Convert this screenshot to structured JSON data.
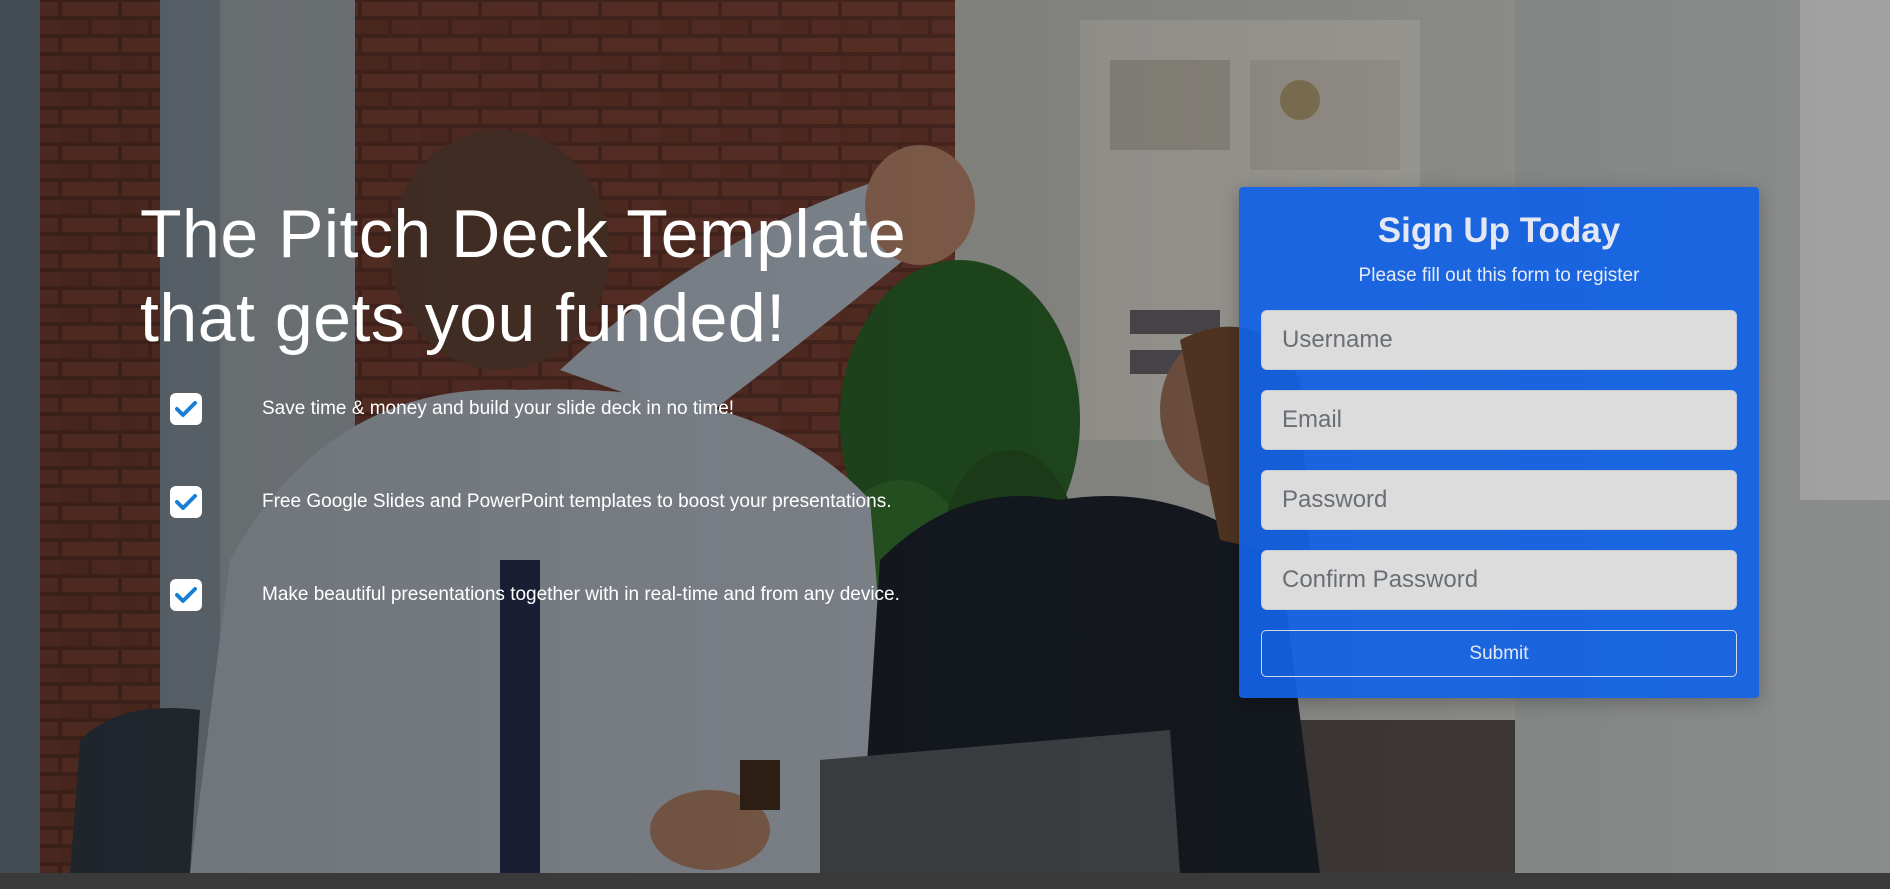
{
  "hero": {
    "headline_part1": "The ",
    "headline_strong": "Pitch Deck Template",
    "headline_line2": "that gets you funded!",
    "background_image_name": "office-high-five-photo"
  },
  "features": [
    {
      "text": "Save time & money and build your slide deck in no time!",
      "icon": "check-icon"
    },
    {
      "text": "Free Google Slides and PowerPoint templates to boost your presentations.",
      "icon": "check-icon"
    },
    {
      "text": "Make beautiful presentations together with in real-time and from any device.",
      "icon": "check-icon"
    }
  ],
  "signup": {
    "title": "Sign Up Today",
    "subtitle": "Please fill out this form to register",
    "username_placeholder": "Username",
    "email_placeholder": "Email",
    "password_placeholder": "Password",
    "confirm_password_placeholder": "Confirm Password",
    "submit_label": "Submit"
  },
  "colors": {
    "card_background": "#1262e6",
    "checkmark": "#1a7fd4",
    "text_light": "#ffffff",
    "input_background": "#dcdcdc"
  }
}
